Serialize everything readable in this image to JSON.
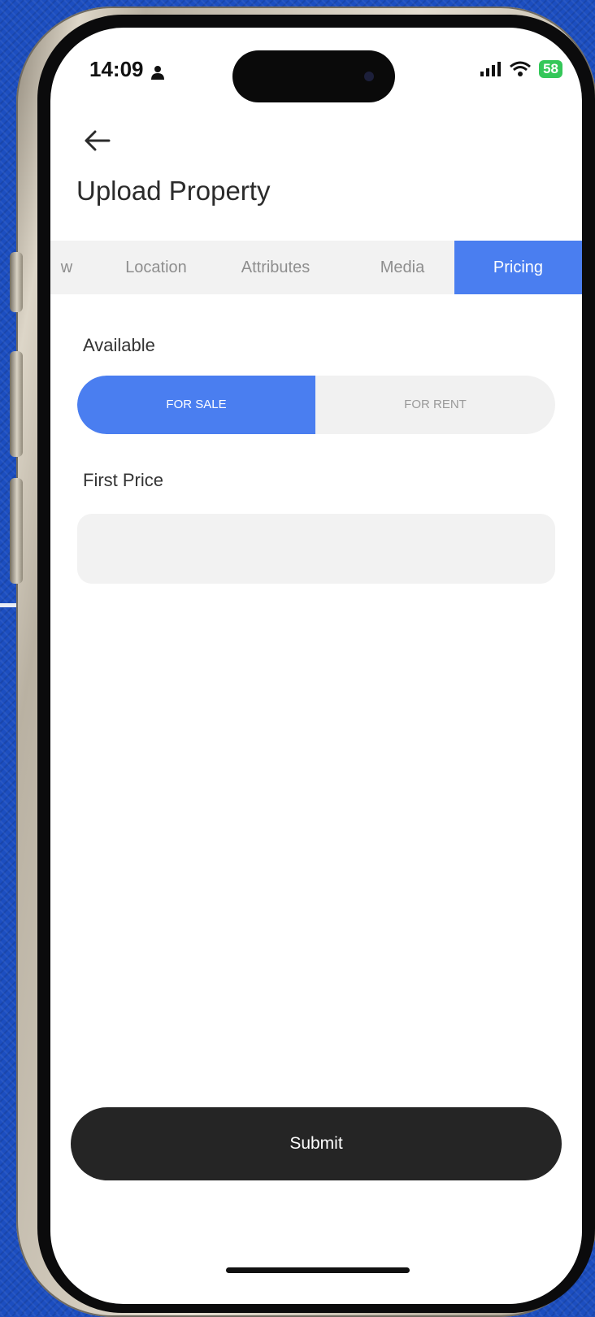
{
  "status_bar": {
    "time": "14:09",
    "battery": "58"
  },
  "header": {
    "title": "Upload Property"
  },
  "tabs": [
    {
      "label": "w",
      "active": false
    },
    {
      "label": "Location",
      "active": false
    },
    {
      "label": "Attributes",
      "active": false
    },
    {
      "label": "Media",
      "active": false
    },
    {
      "label": "Pricing",
      "active": true
    }
  ],
  "available": {
    "label": "Available",
    "options": [
      "FOR SALE",
      "FOR RENT"
    ],
    "selected": "FOR SALE"
  },
  "first_price": {
    "label": "First Price",
    "value": ""
  },
  "submit_label": "Submit",
  "colors": {
    "accent": "#4a7ef0",
    "submit_bg": "#252525",
    "background": "#1c4ec0"
  }
}
